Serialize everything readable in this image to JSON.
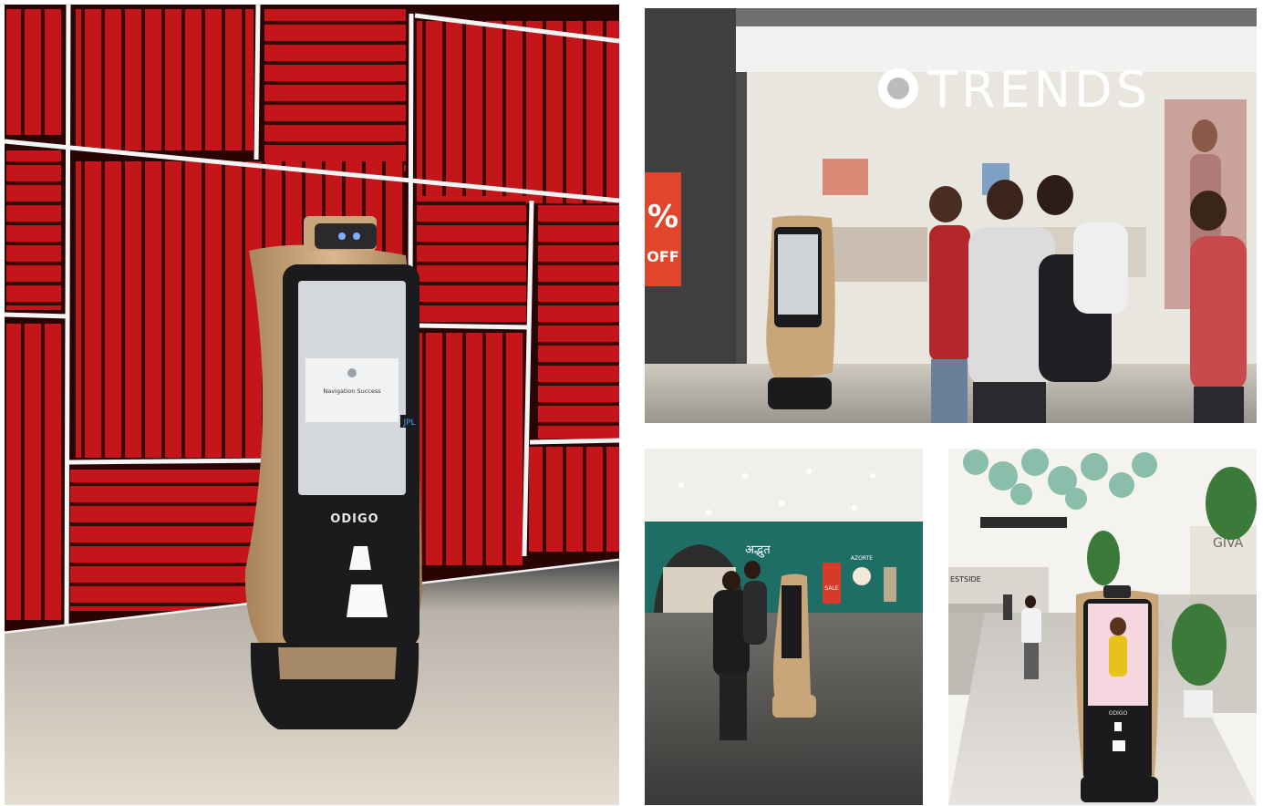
{
  "photos": [
    {
      "name": "robot-red-wall",
      "texts": {
        "robot_brand": "ODIGO",
        "screen_title": "Navigation Success",
        "side_badge": "JPL"
      }
    },
    {
      "name": "robot-trends-store",
      "texts": {
        "store_sign": "TRENDS",
        "promo_percent": "%",
        "promo_off": "OFF"
      }
    },
    {
      "name": "robot-mall-corridor",
      "texts": {
        "store_sign_hindi": "अद्भुत",
        "sale_sign": "SALE",
        "azorte_sign": "AZORTE"
      }
    },
    {
      "name": "robot-walkway",
      "texts": {
        "giva_sign": "GIVA",
        "westside_sign": "ESTSIDE",
        "robot_brand": "ODIGO"
      }
    }
  ],
  "colors": {
    "wall_red": "#c4151a",
    "robot_gold": "#c9a67a",
    "robot_black": "#1b1b1d",
    "floor": "#d9d3c9"
  }
}
